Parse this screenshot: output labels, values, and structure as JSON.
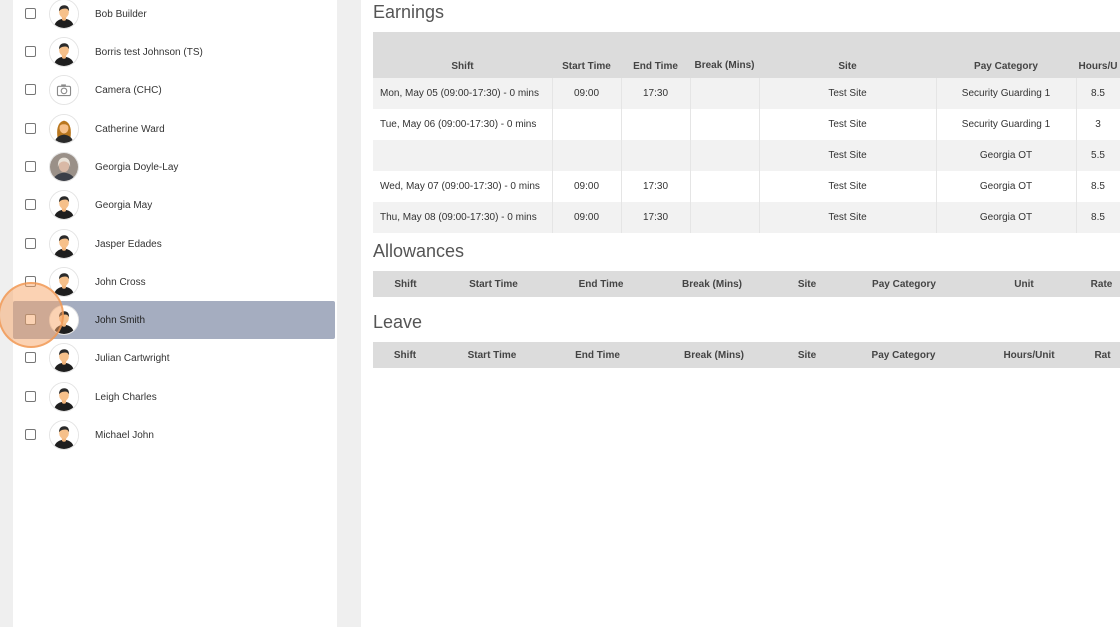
{
  "employees": [
    {
      "name": "Bob Builder",
      "avatar": "male-avatar-icon"
    },
    {
      "name": "Borris test Johnson (TS)",
      "avatar": "male-avatar-icon"
    },
    {
      "name": "Camera (CHC)",
      "avatar": "camera-icon"
    },
    {
      "name": "Catherine Ward",
      "avatar": "female-avatar-icon"
    },
    {
      "name": "Georgia Doyle-Lay",
      "avatar": "photo-avatar-icon"
    },
    {
      "name": "Georgia May",
      "avatar": "male-avatar-icon"
    },
    {
      "name": "Jasper Edades",
      "avatar": "male-avatar-icon"
    },
    {
      "name": "John Cross",
      "avatar": "male-avatar-icon"
    },
    {
      "name": "John Smith",
      "avatar": "male-avatar-icon",
      "selected": true
    },
    {
      "name": "Julian Cartwright",
      "avatar": "male-avatar-icon"
    },
    {
      "name": "Leigh Charles",
      "avatar": "male-avatar-icon"
    },
    {
      "name": "Michael John",
      "avatar": "male-avatar-icon"
    }
  ],
  "earnings": {
    "title": "Earnings",
    "columns": [
      "Shift",
      "Start Time",
      "End Time",
      "Break (Mins)",
      "Site",
      "Pay Category",
      "Hours/U"
    ],
    "rows": [
      [
        "Mon, May 05 (09:00-17:30) - 0 mins",
        "09:00",
        "17:30",
        "",
        "Test Site",
        "Security Guarding 1",
        "8.5"
      ],
      [
        "Tue, May 06 (09:00-17:30) - 0 mins",
        "",
        "",
        "",
        "Test Site",
        "Security Guarding 1",
        "3"
      ],
      [
        "",
        "",
        "",
        "",
        "Test Site",
        "Georgia OT",
        "5.5"
      ],
      [
        "Wed, May 07 (09:00-17:30) - 0 mins",
        "09:00",
        "17:30",
        "",
        "Test Site",
        "Georgia OT",
        "8.5"
      ],
      [
        "Thu, May 08 (09:00-17:30) - 0 mins",
        "09:00",
        "17:30",
        "",
        "Test Site",
        "Georgia OT",
        "8.5"
      ]
    ]
  },
  "allowances": {
    "title": "Allowances",
    "columns": [
      "Shift",
      "Start Time",
      "End Time",
      "Break (Mins)",
      "Site",
      "Pay Category",
      "Unit",
      "Rate"
    ]
  },
  "leave": {
    "title": "Leave",
    "columns": [
      "Shift",
      "Start Time",
      "End Time",
      "Break (Mins)",
      "Site",
      "Pay Category",
      "Hours/Unit",
      "Rat"
    ]
  },
  "colors": {
    "selected_row": "#a5adc0",
    "header_bg": "#dcdcdc",
    "click_highlight": "#f7a668"
  }
}
